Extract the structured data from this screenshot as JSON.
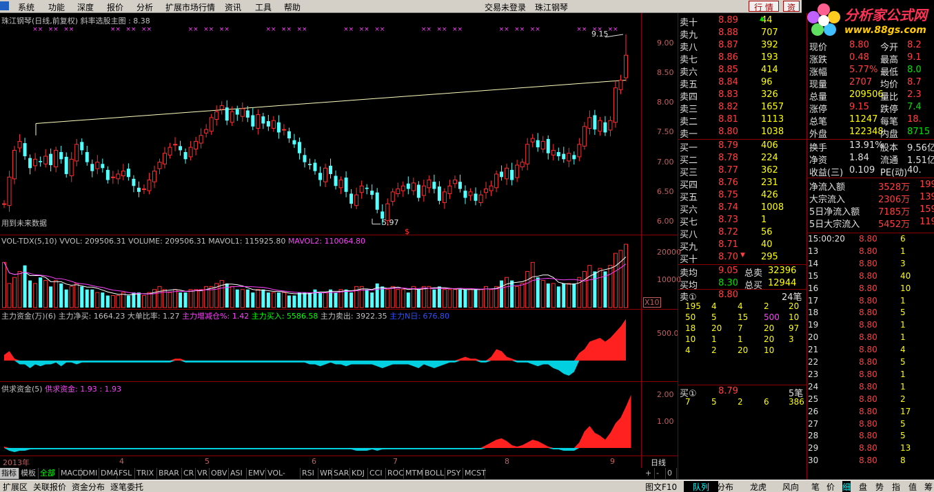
{
  "menu": {
    "items": [
      "系统",
      "功能",
      "深度",
      "报价",
      "分析",
      "扩展市场行情",
      "资讯",
      "工具",
      "帮助"
    ],
    "center": [
      "交易未登录",
      "珠江钢琴"
    ],
    "right_buttons": [
      "行 情",
      "资"
    ]
  },
  "brand": {
    "title": "分析家公式网",
    "url": "www.88gs.com"
  },
  "main_pane": {
    "title": "珠江钢琴(日线,前复权) 斜率选股主图 : 8.38",
    "note": "用到未来数据",
    "high_label": "9.15",
    "low_label": "5.97",
    "s_mark": "$",
    "x_marks_label": "××",
    "yaxis": [
      "9.00",
      "8.50",
      "8.00",
      "7.50",
      "7.00",
      "6.50",
      "6.00"
    ]
  },
  "vol_pane": {
    "title_parts": [
      {
        "text": "VOL-TDX(5,10)",
        "color": "#c0c0c0"
      },
      {
        "text": "VVOL: 209506.31",
        "color": "#c0c0c0"
      },
      {
        "text": "VOLUME: 209506.31",
        "color": "#c0c0c0"
      },
      {
        "text": "MAVOL1: 115925.80",
        "color": "#c0c0c0"
      },
      {
        "text": "MAVOL2: 110064.80",
        "color": "#ff40ff"
      }
    ],
    "yaxis": [
      "20000",
      "10000"
    ],
    "unit": "X10"
  },
  "fund_pane": {
    "title_parts": [
      {
        "text": "主力资金(万)(6)",
        "color": "#c0c0c0"
      },
      {
        "text": "主力净买: 1664.23",
        "color": "#c0c0c0"
      },
      {
        "text": "大单比率: 1.27",
        "color": "#c0c0c0"
      },
      {
        "text": "主力增减仓%: 1.42",
        "color": "#ff40ff"
      },
      {
        "text": "主力买入: 5586.58",
        "color": "#00ff00"
      },
      {
        "text": "主力卖出: 3922.35",
        "color": "#c0c0c0"
      },
      {
        "text": "主力N日: 676.80",
        "color": "#3050ff"
      }
    ],
    "yaxis": [
      "500.0"
    ]
  },
  "supply_pane": {
    "title_parts": [
      {
        "text": "供求资金(5)",
        "color": "#c0c0c0"
      },
      {
        "text": "供求资金: 1.93",
        "color": "#ff40ff"
      },
      {
        "text": ": 1.93",
        "color": "#ff40ff"
      }
    ],
    "yaxis": [
      "2.00",
      "1.00"
    ]
  },
  "xaxis": {
    "labels": [
      "2013年",
      "4",
      "5",
      "6",
      "7",
      "8",
      "9"
    ],
    "period": "日线"
  },
  "tabs": [
    "指标",
    "模板",
    "全部",
    "MACD",
    "DMI",
    "DMA",
    "FSL",
    "TRIX",
    "BRAR",
    "CR",
    "VR",
    "OBV",
    "ASI",
    "EMV",
    "VOL-TDX",
    "RSI",
    "WR",
    "SAR",
    "KDJ",
    "CCI",
    "ROC",
    "MTM",
    "BOLL",
    "PSY",
    "MCST"
  ],
  "tab_controls": [
    "+",
    "-",
    "0"
  ],
  "status": {
    "left": [
      "扩展区",
      "关联报价",
      "资金分布",
      "逐笔委托"
    ],
    "mid": "图文F10",
    "right": [
      "队列",
      "分布",
      "龙虎",
      "风向"
    ],
    "right2": [
      "笔",
      "价",
      "细",
      "盘",
      "势",
      "指",
      "值",
      "筹"
    ]
  },
  "orderbook": {
    "sells": [
      {
        "l": "卖十",
        "p": "8.89",
        "v": "44"
      },
      {
        "l": "卖九",
        "p": "8.88",
        "v": "707"
      },
      {
        "l": "卖八",
        "p": "8.87",
        "v": "392"
      },
      {
        "l": "卖七",
        "p": "8.86",
        "v": "193"
      },
      {
        "l": "卖六",
        "p": "8.85",
        "v": "414"
      },
      {
        "l": "卖五",
        "p": "8.84",
        "v": "96"
      },
      {
        "l": "卖四",
        "p": "8.83",
        "v": "326"
      },
      {
        "l": "卖三",
        "p": "8.82",
        "v": "1657"
      },
      {
        "l": "卖二",
        "p": "8.81",
        "v": "1113"
      },
      {
        "l": "卖一",
        "p": "8.80",
        "v": "1038"
      }
    ],
    "buys": [
      {
        "l": "买一",
        "p": "8.79",
        "v": "406"
      },
      {
        "l": "买二",
        "p": "8.78",
        "v": "224"
      },
      {
        "l": "买三",
        "p": "8.77",
        "v": "362"
      },
      {
        "l": "买四",
        "p": "8.76",
        "v": "231"
      },
      {
        "l": "买五",
        "p": "8.75",
        "v": "426"
      },
      {
        "l": "买六",
        "p": "8.74",
        "v": "1008"
      },
      {
        "l": "买七",
        "p": "8.73",
        "v": "1"
      },
      {
        "l": "买八",
        "p": "8.72",
        "v": "56"
      },
      {
        "l": "买九",
        "p": "8.71",
        "v": "40"
      },
      {
        "l": "买十",
        "p": "8.70",
        "v": "295"
      }
    ],
    "avg": [
      {
        "l": "卖均",
        "p": "9.05",
        "t": "总卖",
        "v": "32396"
      },
      {
        "l": "买均",
        "p": "8.30",
        "t": "总买",
        "v": "12944"
      }
    ],
    "sell1_queue": {
      "label": "卖①",
      "price": "8.80",
      "count": "24笔",
      "rows": [
        [
          "195",
          "4",
          "4",
          "2",
          "20"
        ],
        [
          "50",
          "5",
          "15",
          "500",
          "10"
        ],
        [
          "18",
          "20",
          "7",
          "20",
          "97"
        ],
        [
          "10",
          "1",
          "1",
          "20",
          "3"
        ],
        [
          "4",
          "2",
          "20",
          "10",
          ""
        ]
      ]
    },
    "buy1_queue": {
      "label": "买①",
      "price": "8.79",
      "count": "5笔",
      "rows": [
        [
          "7",
          "5",
          "2",
          "6",
          "386"
        ]
      ]
    }
  },
  "quote": {
    "rows": [
      {
        "a": "现价",
        "b": "8.80",
        "c": "今开",
        "d": "8.2"
      },
      {
        "a": "涨跌",
        "b": "0.48",
        "c": "最高",
        "d": "9.1"
      },
      {
        "a": "涨幅",
        "b": "5.77%",
        "c": "最低",
        "d": "8.0"
      },
      {
        "a": "现量",
        "b": "2707",
        "c": "均价",
        "d": "8.7"
      },
      {
        "a": "总量",
        "b": "209506",
        "c": "量比",
        "d": "2.3"
      },
      {
        "a": "涨停",
        "b": "9.15",
        "c": "跌停",
        "d": "7.4"
      },
      {
        "a": "总笔",
        "b": "11247",
        "c": "每笔",
        "d": "18."
      },
      {
        "a": "外盘",
        "b": "122348",
        "c": "内盘",
        "d": "8715"
      }
    ],
    "rows2": [
      {
        "a": "换手",
        "b": "13.91%",
        "c": "股本",
        "d": "9.56亿"
      },
      {
        "a": "净资",
        "b": "1.84",
        "c": "流通",
        "d": "1.51亿"
      },
      {
        "a": "收益(三)",
        "b": "0.109",
        "c": "PE(动)",
        "d": "40."
      }
    ],
    "flows": [
      {
        "a": "净流入额",
        "b": "3528万",
        "d": "199"
      },
      {
        "a": "大宗流入",
        "b": "2306万",
        "d": "139"
      },
      {
        "a": "5日净流入额",
        "b": "7185万",
        "d": "159"
      },
      {
        "a": "5日大宗流入",
        "b": "5452万",
        "d": "119"
      }
    ]
  },
  "ticks": {
    "rows": [
      {
        "t": "15:00:20",
        "p": "8.80",
        "v": "6"
      },
      {
        "t": "13",
        "p": "8.80",
        "v": "1"
      },
      {
        "t": "14",
        "p": "8.80",
        "v": "3"
      },
      {
        "t": "15",
        "p": "8.80",
        "v": "40"
      },
      {
        "t": "16",
        "p": "8.80",
        "v": "10"
      },
      {
        "t": "17",
        "p": "8.80",
        "v": "1"
      },
      {
        "t": "18",
        "p": "8.80",
        "v": "5"
      },
      {
        "t": "19",
        "p": "8.80",
        "v": "1"
      },
      {
        "t": "20",
        "p": "8.80",
        "v": "1"
      },
      {
        "t": "21",
        "p": "8.80",
        "v": "4"
      },
      {
        "t": "22",
        "p": "8.80",
        "v": "5"
      },
      {
        "t": "23",
        "p": "8.80",
        "v": "1"
      },
      {
        "t": "24",
        "p": "8.80",
        "v": "1"
      },
      {
        "t": "25",
        "p": "8.80",
        "v": "2"
      },
      {
        "t": "26",
        "p": "8.80",
        "v": "17"
      },
      {
        "t": "27",
        "p": "8.80",
        "v": "5"
      },
      {
        "t": "28",
        "p": "8.80",
        "v": "5"
      },
      {
        "t": "29",
        "p": "8.80",
        "v": "13"
      },
      {
        "t": "30",
        "p": "8.80",
        "v": "8"
      }
    ]
  },
  "chart_data": {
    "type": "candlestick",
    "title": "珠江钢琴(日线,前复权) 斜率选股主图 : 8.38",
    "ylim": [
      5.85,
      9.3
    ],
    "closes": [
      6.3,
      6.75,
      7.2,
      7.35,
      7.1,
      6.9,
      7.05,
      7.0,
      7.1,
      6.95,
      7.2,
      7.05,
      6.8,
      7.05,
      7.3,
      7.2,
      7.0,
      6.85,
      7.0,
      6.9,
      6.7,
      6.75,
      6.8,
      6.85,
      6.75,
      6.6,
      6.5,
      6.55,
      6.7,
      6.85,
      7.0,
      7.15,
      7.25,
      7.3,
      7.2,
      7.05,
      7.25,
      7.35,
      7.45,
      7.55,
      7.75,
      7.85,
      7.95,
      7.7,
      7.85,
      7.8,
      7.9,
      7.75,
      7.6,
      7.8,
      7.65,
      7.6,
      7.7,
      7.5,
      7.55,
      7.4,
      7.3,
      7.15,
      7.0,
      6.95,
      6.85,
      6.7,
      6.9,
      6.8,
      6.6,
      6.7,
      6.5,
      6.3,
      6.45,
      6.6,
      6.55,
      6.45,
      6.2,
      6.05,
      6.3,
      6.5,
      6.55,
      6.6,
      6.55,
      6.65,
      6.4,
      6.6,
      6.7,
      6.55,
      6.35,
      6.5,
      6.6,
      6.7,
      6.55,
      6.4,
      6.5,
      6.35,
      6.45,
      6.55,
      6.6,
      6.8,
      6.75,
      6.9,
      6.7,
      6.95,
      7.0,
      7.3,
      7.4,
      7.25,
      7.35,
      7.15,
      7.2,
      7.1,
      7.05,
      7.15,
      7.05,
      7.3,
      7.6,
      7.75,
      7.55,
      7.7,
      7.5,
      7.7,
      8.25,
      8.38,
      8.8
    ],
    "vol": [
      15,
      8,
      10,
      12,
      14,
      9,
      8,
      10,
      9,
      7,
      9,
      8,
      6,
      7,
      8,
      7,
      6,
      6,
      5,
      5,
      4,
      4,
      4,
      5,
      4,
      5,
      5,
      4,
      5,
      6,
      7,
      6,
      5,
      6,
      5,
      5,
      6,
      6,
      6,
      7,
      7,
      8,
      9,
      8,
      7,
      6,
      6,
      6,
      5,
      6,
      6,
      5,
      5,
      5,
      5,
      4,
      4,
      5,
      5,
      5,
      6,
      5,
      5,
      6,
      5,
      6,
      6,
      5,
      7,
      7,
      6,
      5,
      8,
      7,
      6,
      7,
      6,
      6,
      5,
      7,
      6,
      7,
      7,
      6,
      7,
      6,
      6,
      6,
      6,
      6,
      6,
      6,
      6,
      7,
      6,
      7,
      9,
      10,
      9,
      7,
      8,
      12,
      15,
      10,
      9,
      8,
      8,
      7,
      8,
      8,
      8,
      10,
      12,
      14,
      12,
      13,
      12,
      14,
      18,
      19,
      21
    ],
    "fund": [
      0.15,
      0.25,
      0.05,
      -0.1,
      -0.1,
      -0.2,
      -0.1,
      -0.15,
      -0.1,
      -0.1,
      -0.05,
      -0.15,
      -0.05,
      -0.05,
      -0.1,
      -0.05,
      -0.05,
      -0.05,
      -0.05,
      -0.05,
      -0.05,
      -0.05,
      -0.05,
      -0.05,
      -0.05,
      -0.05,
      -0.05,
      -0.05,
      -0.05,
      -0.05,
      -0.05,
      -0.05,
      -0.05,
      0.05,
      0.05,
      -0.05,
      -0.05,
      -0.05,
      -0.05,
      -0.05,
      -0.05,
      -0.05,
      -0.05,
      -0.05,
      -0.05,
      -0.05,
      -0.05,
      -0.05,
      -0.05,
      -0.05,
      -0.05,
      -0.05,
      -0.05,
      -0.05,
      -0.05,
      -0.05,
      -0.05,
      -0.05,
      -0.05,
      -0.1,
      -0.1,
      -0.15,
      -0.1,
      -0.05,
      -0.1,
      -0.1,
      -0.15,
      -0.1,
      -0.1,
      -0.1,
      -0.1,
      -0.1,
      -0.15,
      -0.2,
      -0.15,
      -0.1,
      -0.1,
      -0.1,
      -0.1,
      -0.15,
      -0.2,
      -0.1,
      -0.15,
      -0.2,
      -0.15,
      -0.1,
      -0.05,
      -0.05,
      0.05,
      0.1,
      0.05,
      0.05,
      -0.05,
      -0.05,
      0.1,
      0.3,
      0.25,
      0.1,
      0.05,
      -0.05,
      -0.05,
      -0.05,
      -0.1,
      -0.15,
      -0.1,
      -0.1,
      -0.2,
      -0.25,
      -0.35,
      -0.4,
      -0.3,
      0.2,
      0.3,
      0.5,
      0.55,
      0.6,
      0.5,
      0.6,
      0.75,
      0.9,
      1.1
    ],
    "supply": [
      0.05,
      -0.1,
      -0.15,
      -0.1,
      -0.1,
      -0.05,
      -0.05,
      -0.05,
      -0.05,
      -0.05,
      -0.05,
      -0.05,
      -0.05,
      -0.05,
      -0.05,
      -0.05,
      -0.05,
      -0.05,
      -0.05,
      -0.05,
      -0.05,
      -0.05,
      -0.05,
      -0.05,
      -0.05,
      -0.05,
      -0.05,
      -0.05,
      -0.05,
      -0.05,
      -0.05,
      -0.05,
      -0.05,
      -0.05,
      -0.05,
      -0.05,
      -0.05,
      -0.05,
      -0.05,
      -0.05,
      -0.05,
      -0.05,
      -0.05,
      -0.05,
      -0.05,
      -0.05,
      -0.05,
      -0.05,
      -0.05,
      -0.05,
      -0.05,
      -0.05,
      -0.05,
      -0.05,
      -0.05,
      -0.05,
      -0.05,
      -0.05,
      -0.05,
      -0.05,
      -0.05,
      -0.05,
      -0.05,
      -0.05,
      -0.05,
      -0.05,
      -0.05,
      -0.05,
      -0.1,
      -0.1,
      -0.1,
      -0.05,
      -0.1,
      -0.05,
      -0.05,
      -0.05,
      -0.05,
      -0.05,
      -0.05,
      -0.05,
      -0.05,
      -0.05,
      -0.05,
      -0.05,
      -0.05,
      -0.05,
      -0.05,
      -0.05,
      -0.05,
      -0.05,
      -0.05,
      -0.05,
      -0.05,
      0.1,
      0.2,
      0.3,
      0.35,
      0.25,
      0.1,
      0.05,
      0.1,
      0.2,
      0.3,
      0.25,
      0.15,
      0.05,
      -0.05,
      -0.05,
      -0.1,
      -0.1,
      -0.1,
      0.2,
      0.6,
      0.8,
      0.55,
      0.45,
      0.3,
      0.55,
      0.9,
      1.1,
      1.5,
      1.93
    ]
  }
}
